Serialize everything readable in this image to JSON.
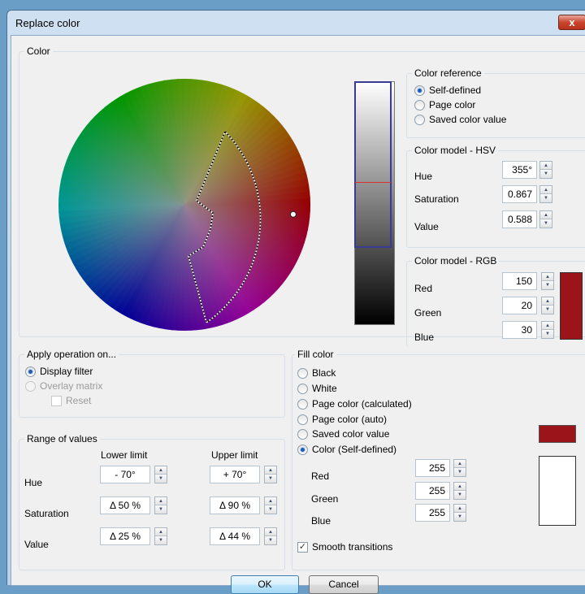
{
  "window": {
    "title": "Replace color",
    "close_label": "x"
  },
  "color_group": {
    "legend": "Color",
    "selected_rgb_hex": "#961e1e",
    "picker_pointer": {
      "hue_deg": 355,
      "saturation": 0.867
    }
  },
  "color_reference": {
    "legend": "Color reference",
    "options": [
      {
        "label": "Self-defined",
        "selected": true
      },
      {
        "label": "Page color",
        "selected": false
      },
      {
        "label": "Saved color value",
        "selected": false
      }
    ]
  },
  "hsv": {
    "legend": "Color model - HSV",
    "hue": {
      "label": "Hue",
      "value": "355°"
    },
    "saturation": {
      "label": "Saturation",
      "value": "0.867"
    },
    "value": {
      "label": "Value",
      "value": "0.588"
    },
    "value_slider_level": 0.588
  },
  "rgb": {
    "legend": "Color model - RGB",
    "red": {
      "label": "Red",
      "value": "150"
    },
    "green": {
      "label": "Green",
      "value": "20"
    },
    "blue": {
      "label": "Blue",
      "value": "30"
    },
    "swatch_color": "#9b1419"
  },
  "apply_operation": {
    "legend": "Apply operation on...",
    "display_filter": "Display filter",
    "overlay_matrix": "Overlay matrix",
    "reset": "Reset"
  },
  "range": {
    "legend": "Range of values",
    "lower_header": "Lower limit",
    "upper_header": "Upper limit",
    "rows": [
      {
        "label": "Hue",
        "lower": "- 70°",
        "upper": "+ 70°"
      },
      {
        "label": "Saturation",
        "lower": "Δ 50 %",
        "upper": "Δ 90 %"
      },
      {
        "label": "Value",
        "lower": "Δ 25 %",
        "upper": "Δ 44 %"
      }
    ]
  },
  "fill_color": {
    "legend": "Fill color",
    "options": [
      {
        "label": "Black",
        "selected": false
      },
      {
        "label": "White",
        "selected": false
      },
      {
        "label": "Page color (calculated)",
        "selected": false
      },
      {
        "label": "Page color (auto)",
        "selected": false
      },
      {
        "label": "Saved color value",
        "selected": false
      },
      {
        "label": "Color (Self-defined)",
        "selected": true
      }
    ],
    "saved_swatch_color": "#9b1419",
    "red": {
      "label": "Red",
      "value": "255"
    },
    "green": {
      "label": "Green",
      "value": "255"
    },
    "blue": {
      "label": "Blue",
      "value": "255"
    },
    "custom_swatch_color": "#ffffff",
    "smooth_transitions": "Smooth transitions",
    "smooth_checked": true
  },
  "buttons": {
    "ok": "OK",
    "cancel": "Cancel"
  }
}
